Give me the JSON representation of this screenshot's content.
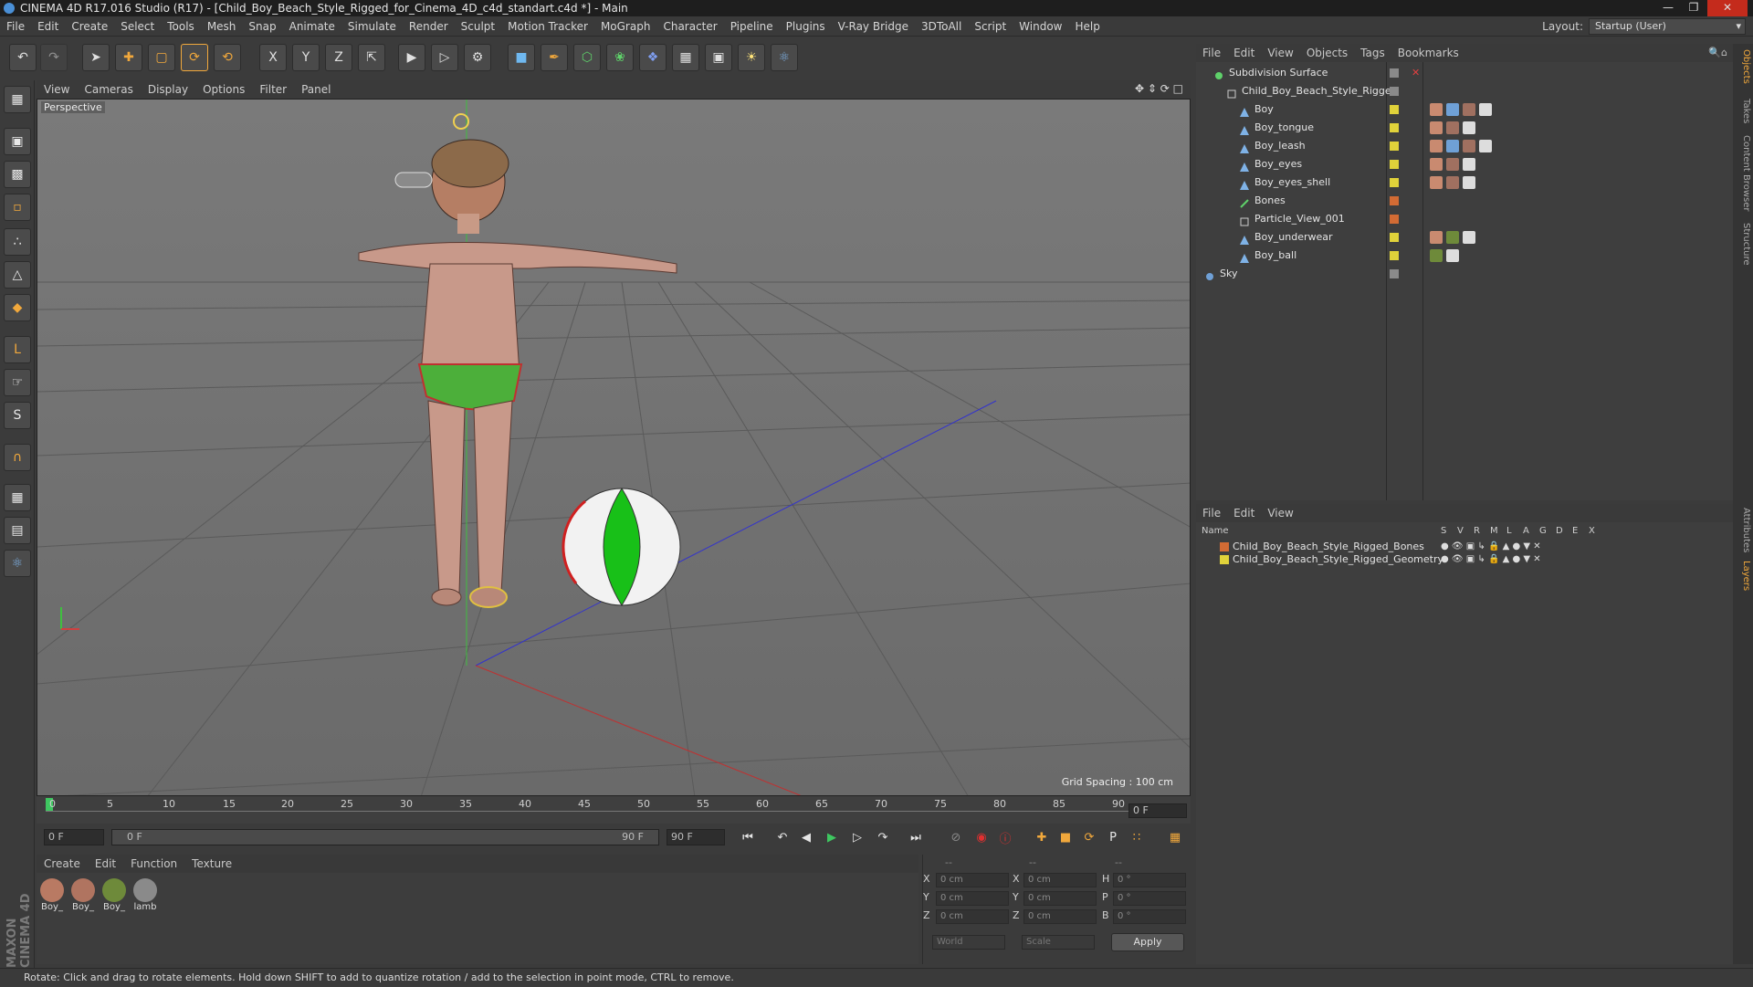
{
  "window": {
    "title": "CINEMA 4D R17.016 Studio (R17) - [Child_Boy_Beach_Style_Rigged_for_Cinema_4D_c4d_standart.c4d *] - Main"
  },
  "menubar": {
    "items": [
      "File",
      "Edit",
      "Create",
      "Select",
      "Tools",
      "Mesh",
      "Snap",
      "Animate",
      "Simulate",
      "Render",
      "Sculpt",
      "Motion Tracker",
      "MoGraph",
      "Character",
      "Pipeline",
      "Plugins",
      "V-Ray Bridge",
      "3DToAll",
      "Script",
      "Window",
      "Help"
    ],
    "layout_label": "Layout:",
    "layout_value": "Startup (User)"
  },
  "viewport": {
    "menu": [
      "View",
      "Cameras",
      "Display",
      "Options",
      "Filter",
      "Panel"
    ],
    "label": "Perspective",
    "grid_spacing": "Grid Spacing : 100 cm"
  },
  "timeline": {
    "ticks": [
      "0",
      "5",
      "10",
      "15",
      "20",
      "25",
      "30",
      "35",
      "40",
      "45",
      "50",
      "55",
      "60",
      "65",
      "70",
      "75",
      "80",
      "85",
      "90"
    ],
    "current_frame": "0 F",
    "start_field": "0 F",
    "range_start": "0 F",
    "range_end": "90 F",
    "end_field": "90 F"
  },
  "material_manager": {
    "menu": [
      "Create",
      "Edit",
      "Function",
      "Texture"
    ],
    "materials": [
      {
        "name": "Boy_",
        "color": "#b97a63"
      },
      {
        "name": "Boy_",
        "color": "#b07460"
      },
      {
        "name": "Boy_",
        "color": "#6e8a3a"
      },
      {
        "name": "lamb",
        "color": "#8a8a8a"
      }
    ]
  },
  "coordinates": {
    "header": [
      "--",
      "--",
      "--"
    ],
    "rows": [
      {
        "l1": "X",
        "v1": "0 cm",
        "l2": "X",
        "v2": "0 cm",
        "l3": "H",
        "v3": "0 °"
      },
      {
        "l1": "Y",
        "v1": "0 cm",
        "l2": "Y",
        "v2": "0 cm",
        "l3": "P",
        "v3": "0 °"
      },
      {
        "l1": "Z",
        "v1": "0 cm",
        "l2": "Z",
        "v2": "0 cm",
        "l3": "B",
        "v3": "0 °"
      }
    ],
    "world": "World",
    "scale": "Scale",
    "apply": "Apply"
  },
  "object_manager": {
    "menu": [
      "File",
      "Edit",
      "View",
      "Objects",
      "Tags",
      "Bookmarks"
    ],
    "objects": [
      {
        "name": "Subdivision Surface",
        "indent": 0,
        "color": "#8a8a8a"
      },
      {
        "name": "Child_Boy_Beach_Style_Rigged",
        "indent": 1,
        "color": "#8a8a8a"
      },
      {
        "name": "Boy",
        "indent": 2,
        "color": "#e0d23a"
      },
      {
        "name": "Boy_tongue",
        "indent": 2,
        "color": "#e0d23a"
      },
      {
        "name": "Boy_leash",
        "indent": 2,
        "color": "#e0d23a"
      },
      {
        "name": "Boy_eyes",
        "indent": 2,
        "color": "#e0d23a"
      },
      {
        "name": "Boy_eyes_shell",
        "indent": 2,
        "color": "#e0d23a"
      },
      {
        "name": "Bones",
        "indent": 2,
        "color": "#d26b34"
      },
      {
        "name": "Particle_View_001",
        "indent": 2,
        "color": "#d26b34"
      },
      {
        "name": "Boy_underwear",
        "indent": 2,
        "color": "#e0d23a"
      },
      {
        "name": "Boy_ball",
        "indent": 2,
        "color": "#e0d23a"
      },
      {
        "name": "Sky",
        "indent": 0,
        "color": "#8a8a8a"
      }
    ]
  },
  "layer_manager": {
    "menu": [
      "File",
      "Edit",
      "View"
    ],
    "columns": [
      "Name",
      "S",
      "V",
      "R",
      "M",
      "L",
      "A",
      "G",
      "D",
      "E",
      "X"
    ],
    "layers": [
      {
        "name": "Child_Boy_Beach_Style_Rigged_Bones",
        "color": "#d26b34"
      },
      {
        "name": "Child_Boy_Beach_Style_Rigged_Geometry",
        "color": "#e0d23a"
      }
    ]
  },
  "right_tabs": [
    "Objects",
    "Takes",
    "Content Browser",
    "Structure",
    "Attributes",
    "Layers"
  ],
  "maxon_logo": "MAXON CINEMA 4D",
  "status": "Rotate: Click and drag to rotate elements. Hold down SHIFT to add to quantize rotation / add to the selection in point mode, CTRL to remove."
}
